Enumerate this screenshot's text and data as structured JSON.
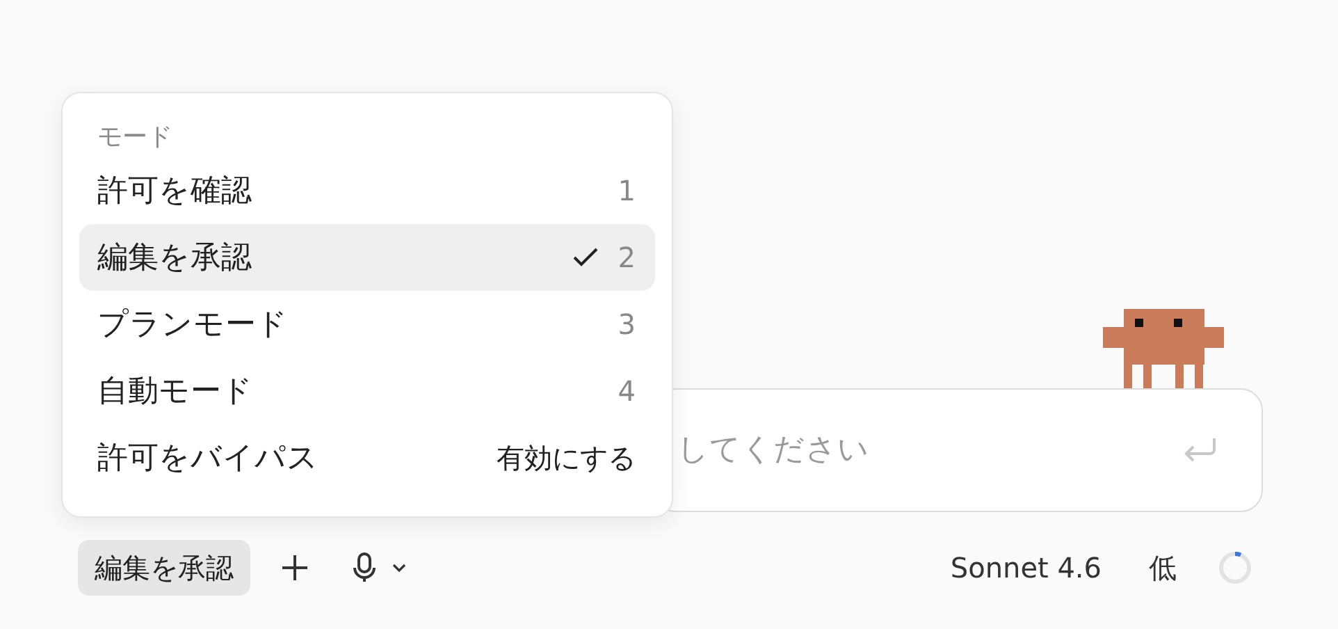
{
  "mode_menu": {
    "header": "モード",
    "items": [
      {
        "label": "許可を確認",
        "hint": "1",
        "selected": false
      },
      {
        "label": "編集を承認",
        "hint": "2",
        "selected": true
      },
      {
        "label": "プランモード",
        "hint": "3",
        "selected": false
      },
      {
        "label": "自動モード",
        "hint": "4",
        "selected": false
      },
      {
        "label": "許可をバイパス",
        "hint": "有効にする",
        "selected": false
      }
    ]
  },
  "message_field": {
    "placeholder": "してください"
  },
  "toolbar": {
    "mode_button": "編集を承認",
    "model": "Sonnet 4.6",
    "effort": "低"
  }
}
